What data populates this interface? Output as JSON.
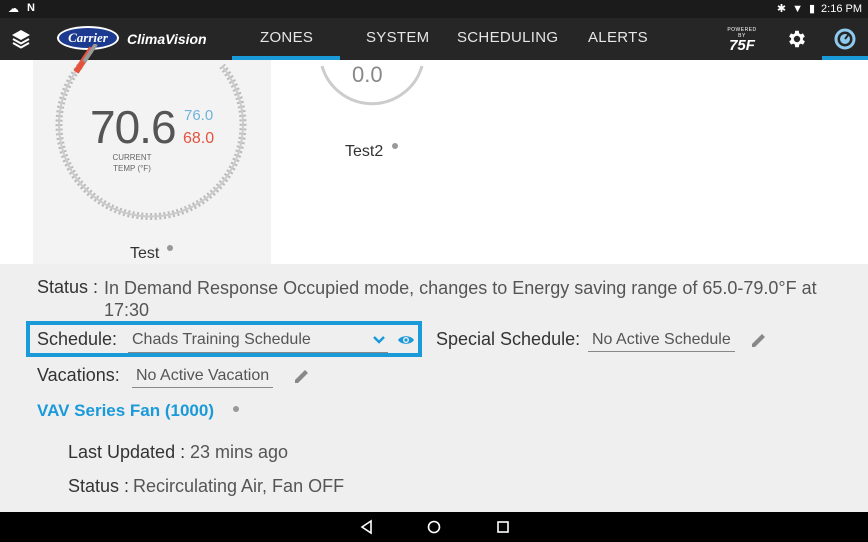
{
  "statusbar": {
    "time": "2:16 PM"
  },
  "appbar": {
    "logo_text": "Carrier",
    "brand_name": "ClimaVision",
    "tabs": [
      {
        "label": "ZONES",
        "active": true
      },
      {
        "label": "SYSTEM",
        "active": false
      },
      {
        "label": "SCHEDULING",
        "active": false
      },
      {
        "label": "ALERTS",
        "active": false
      }
    ],
    "powered_small": "POWERED BY",
    "powered_big": "75F"
  },
  "zones": [
    {
      "name": "Test",
      "current_temp": "70.6",
      "cooling_setpoint": "76.0",
      "heating_setpoint": "68.0",
      "current_label_line1": "CURRENT",
      "current_label_line2": "TEMP (°F)"
    },
    {
      "name": "Test2",
      "current_temp": "0.0"
    }
  ],
  "details": {
    "status_label": "Status :",
    "status_text": "In Demand Response Occupied mode, changes to Energy saving range of 65.0-79.0°F at 17:30",
    "schedule_label": "Schedule:",
    "schedule_value": "Chads Training Schedule",
    "special_schedule_label": "Special Schedule:",
    "special_schedule_value": "No Active Schedule",
    "vacations_label": "Vacations:",
    "vacations_value": "No Active Vacation",
    "equipment_name": "VAV Series Fan (1000)",
    "last_updated_label": "Last Updated :",
    "last_updated_value": "23 mins ago",
    "equip_status_label": "Status :",
    "equip_status_value": "Recirculating Air, Fan OFF"
  },
  "colors": {
    "accent": "#1a9ad9",
    "heat": "#e5533d",
    "cool": "#6fb3dc",
    "appbar": "#262626"
  }
}
